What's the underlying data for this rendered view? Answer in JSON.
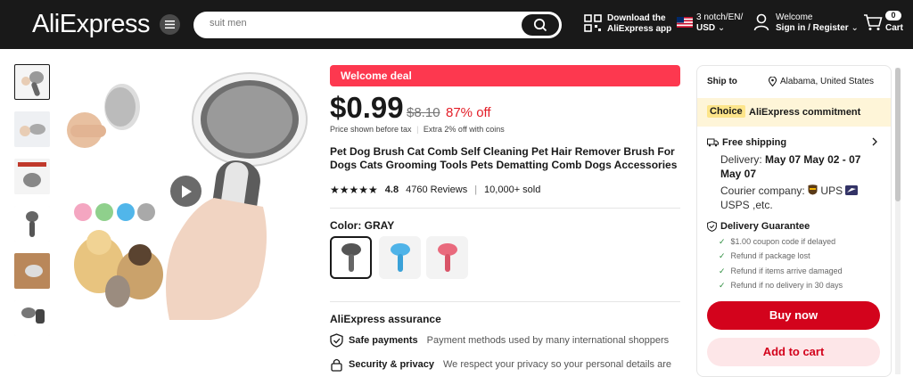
{
  "header": {
    "logo": "AliExpress",
    "search_placeholder": "suit men",
    "download_line1": "Download the",
    "download_line2": "AliExpress app",
    "locale_line1": "3 notch/EN/",
    "locale_line2": "USD",
    "welcome_line1": "Welcome",
    "welcome_line2": "Sign in / Register",
    "cart_count": "0",
    "cart_label": "Cart"
  },
  "product": {
    "welcome_deal": "Welcome deal",
    "price": "$0.99",
    "old_price": "$8.10",
    "discount": "87% off",
    "tax_note": "Price shown before tax",
    "coins_note": "Extra 2% off with coins",
    "title": "Pet Dog Brush Cat Comb Self Cleaning Pet Hair Remover Brush For Dogs Cats Grooming Tools Pets Dematting Comb Dogs Accessories",
    "rating": "4.8",
    "reviews": "4760 Reviews",
    "sold": "10,000+ sold",
    "stars": 5,
    "color_label": "Color: GRAY",
    "swatches": [
      "gray",
      "blue",
      "pink"
    ],
    "assurance_title": "AliExpress assurance",
    "assurance": [
      {
        "title": "Safe payments",
        "desc": "Payment methods used by many international shoppers"
      },
      {
        "title": "Security & privacy",
        "desc": "We respect your privacy so your personal details are"
      }
    ]
  },
  "shipping": {
    "ship_to_label": "Ship to",
    "location": "Alabama, United States",
    "choice_tag": "Choice",
    "commitment": "AliExpress commitment",
    "free_shipping": "Free shipping",
    "delivery_label": "Delivery:",
    "delivery_dates": "May 07 May 02 - 07 May 07",
    "courier_label": "Courier company:",
    "courier": "UPS",
    "courier_more": "USPS ,etc.",
    "guarantee_title": "Delivery Guarantee",
    "guarantees": [
      "$1.00 coupon code if delayed",
      "Refund if package lost",
      "Refund if items arrive damaged",
      "Refund if no delivery in 30 days"
    ],
    "buy_now": "Buy now",
    "add_to_cart": "Add to cart"
  },
  "colors": {
    "header_bg": "#191919",
    "deal_red": "#fd384f",
    "discount_red": "#e31d27",
    "buy_red": "#d3031c",
    "choice_yellow": "#fde58a"
  }
}
